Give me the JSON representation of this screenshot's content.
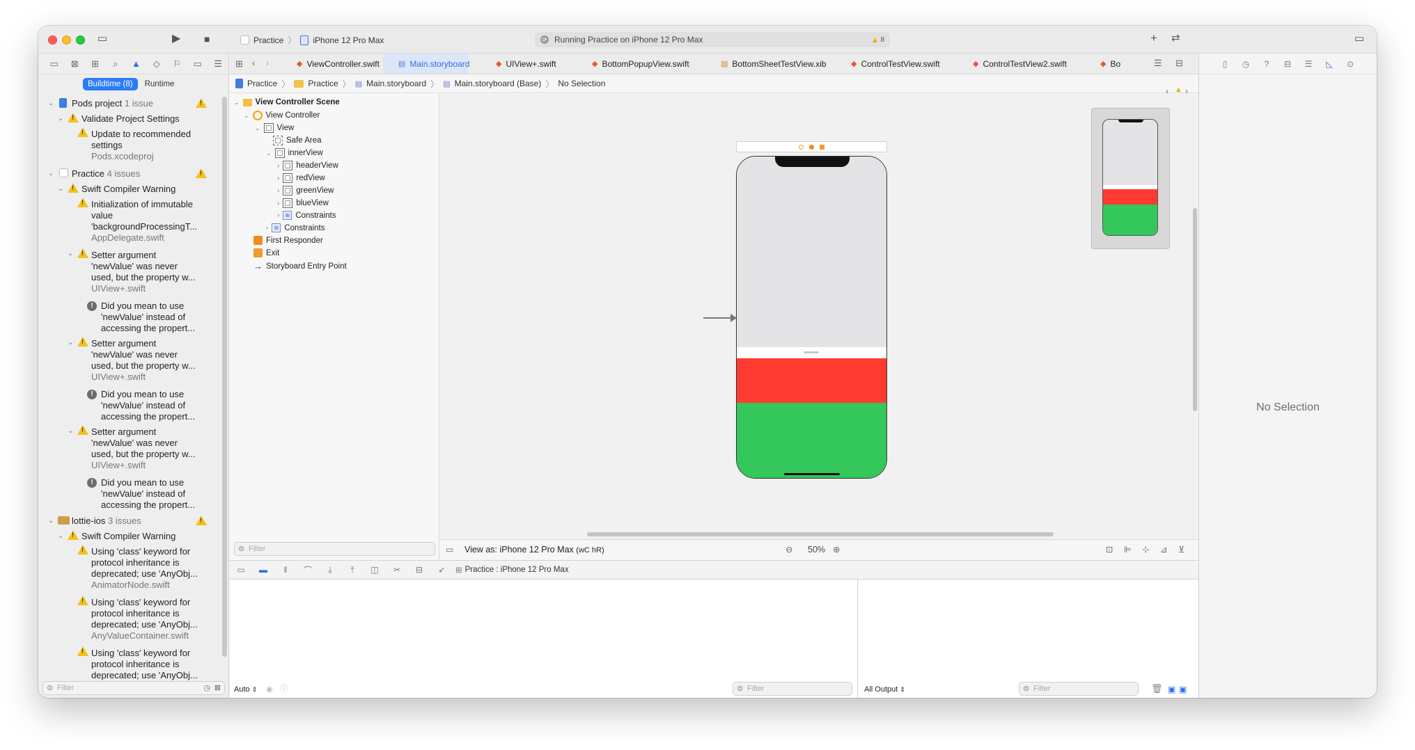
{
  "toolbar": {
    "scheme_app": "Practice",
    "scheme_device": "iPhone 12 Pro Max",
    "activity_text": "Running Practice on iPhone 12 Pro Max",
    "warning_count": "8"
  },
  "navigator": {
    "segments": {
      "buildtime": "Buildtime (8)",
      "runtime": "Runtime"
    },
    "filter_placeholder": "Filter",
    "groups": [
      {
        "title": "Pods project",
        "count": "1 issue"
      },
      {
        "title": "Validate Project Settings"
      },
      {
        "title": "Update to recommended settings",
        "file": "Pods.xcodeproj"
      },
      {
        "title": "Practice",
        "count": "4 issues"
      },
      {
        "title": "Swift Compiler Warning"
      },
      {
        "l1": "Initialization of immutable",
        "l2": "value",
        "l3": "'backgroundProcessingT...",
        "file": "AppDelegate.swift"
      },
      {
        "l1": "Setter argument",
        "l2": "'newValue' was never",
        "l3": "used, but the property w...",
        "file": "UIView+.swift"
      },
      {
        "l1": "Did you mean to use",
        "l2": "'newValue' instead of",
        "l3": "accessing the propert..."
      },
      {
        "l1": "Setter argument",
        "l2": "'newValue' was never",
        "l3": "used, but the property w...",
        "file": "UIView+.swift"
      },
      {
        "l1": "Did you mean to use",
        "l2": "'newValue' instead of",
        "l3": "accessing the propert..."
      },
      {
        "l1": "Setter argument",
        "l2": "'newValue' was never",
        "l3": "used, but the property w...",
        "file": "UIView+.swift"
      },
      {
        "l1": "Did you mean to use",
        "l2": "'newValue' instead of",
        "l3": "accessing the propert..."
      },
      {
        "title": "lottie-ios",
        "count": "3 issues"
      },
      {
        "title": "Swift Compiler Warning"
      },
      {
        "l1": "Using 'class' keyword for",
        "l2": "protocol inheritance is",
        "l3": "deprecated; use 'AnyObj...",
        "file": "AnimatorNode.swift"
      },
      {
        "l1": "Using 'class' keyword for",
        "l2": "protocol inheritance is",
        "l3": "deprecated; use 'AnyObj...",
        "file": "AnyValueContainer.swift"
      },
      {
        "l1": "Using 'class' keyword for",
        "l2": "protocol inheritance is",
        "l3": "deprecated; use 'AnyObj..."
      }
    ]
  },
  "tabs": [
    "ViewController.swift",
    "Main.storyboard",
    "UIView+.swift",
    "BottomPopupView.swift",
    "BottomSheetTestView.xib",
    "ControlTestView.swift",
    "ControlTestView2.swift",
    "Bo"
  ],
  "jumpbar": [
    "Practice",
    "Practice",
    "Main.storyboard",
    "Main.storyboard (Base)",
    "No Selection"
  ],
  "outline": {
    "scene": "View Controller Scene",
    "items": [
      "View Controller",
      "View",
      "Safe Area",
      "innerView",
      "headerView",
      "redView",
      "greenView",
      "blueView",
      "Constraints",
      "Constraints",
      "First Responder",
      "Exit",
      "Storyboard Entry Point"
    ],
    "filter_placeholder": "Filter"
  },
  "canvas": {
    "view_as": "View as: iPhone 12 Pro Max",
    "size_class": "(wC hR)",
    "zoom": "50%",
    "colors": {
      "gray": "#e4e4e6",
      "red": "#ff3a30",
      "green": "#34c759"
    }
  },
  "debug": {
    "breadcrumb": "Practice : iPhone 12 Pro Max",
    "auto_label": "Auto",
    "left_filter": "Filter",
    "output_label": "All Output",
    "right_filter": "Filter"
  },
  "inspector": {
    "no_selection": "No Selection"
  }
}
